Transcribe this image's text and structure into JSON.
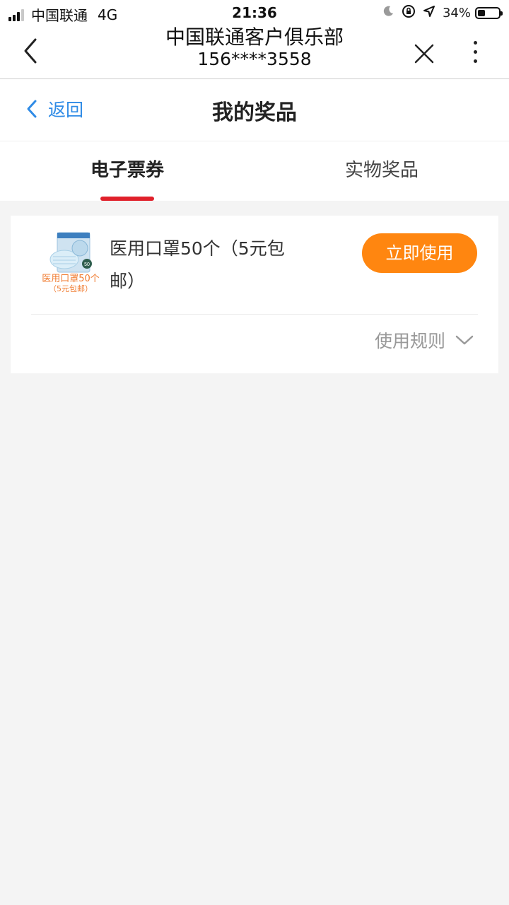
{
  "status_bar": {
    "carrier": "中国联通",
    "network": "4G",
    "time": "21:36",
    "battery_percent": "34%",
    "battery_level": 0.34
  },
  "nav_bar": {
    "title": "中国联通客户俱乐部",
    "subtitle": "156****3558"
  },
  "page_header": {
    "back_label": "返回",
    "title": "我的奖品"
  },
  "tabs": [
    {
      "label": "电子票券",
      "active": true
    },
    {
      "label": "实物奖品",
      "active": false
    }
  ],
  "prizes": [
    {
      "thumbnail_caption": "医用口罩50个",
      "thumbnail_subcaption": "（5元包邮）",
      "thumbnail_badge": "50",
      "name": "医用口罩50个（5元包邮）",
      "action_label": "立即使用",
      "rules_label": "使用规则"
    }
  ],
  "colors": {
    "accent_red": "#e0202a",
    "button_orange": "#ff8610",
    "link_blue": "#2f8be6",
    "background": "#f4f4f4"
  }
}
